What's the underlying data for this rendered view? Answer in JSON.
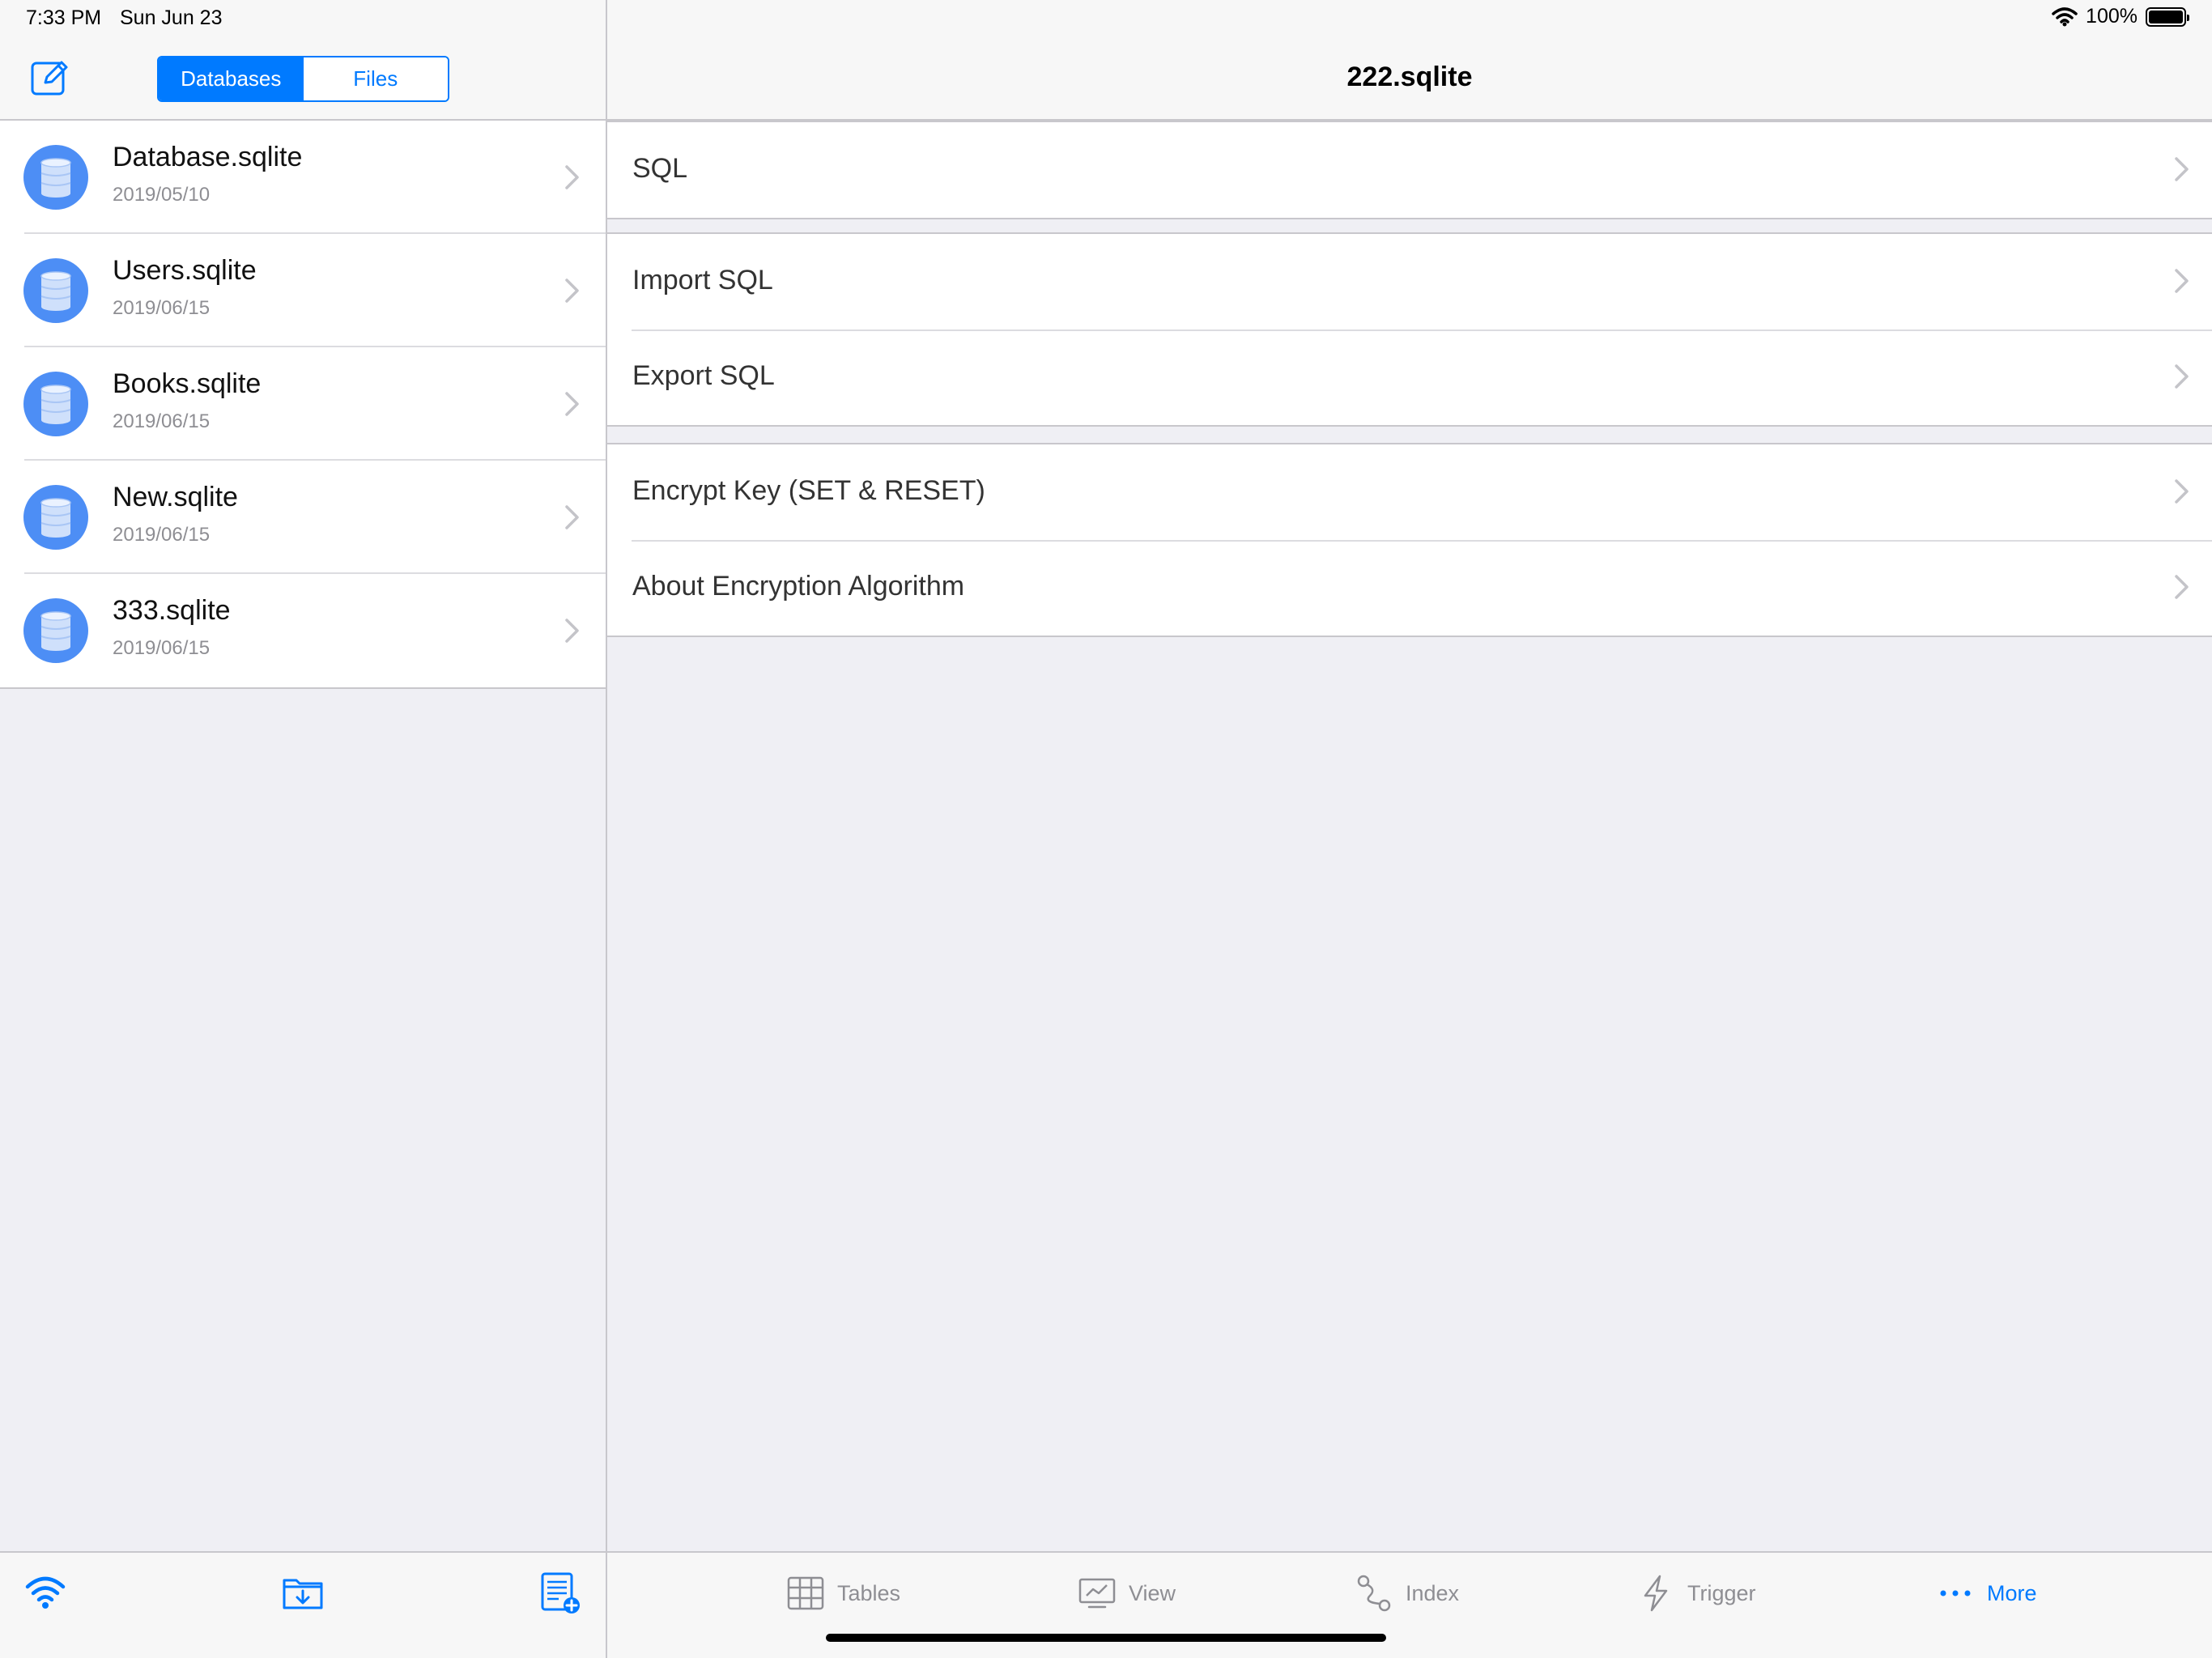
{
  "status_bar": {
    "time": "7:33 PM",
    "date": "Sun Jun 23",
    "battery": "100%",
    "battery_level": 1.0
  },
  "left": {
    "segments": [
      {
        "label": "Databases",
        "selected": true
      },
      {
        "label": "Files",
        "selected": false
      }
    ],
    "databases": [
      {
        "name": "Database.sqlite",
        "date": "2019/05/10"
      },
      {
        "name": "Users.sqlite",
        "date": "2019/06/15"
      },
      {
        "name": "Books.sqlite",
        "date": "2019/06/15"
      },
      {
        "name": "New.sqlite",
        "date": "2019/06/15"
      },
      {
        "name": "333.sqlite",
        "date": "2019/06/15"
      }
    ],
    "toolbar_icons": [
      "wifi-icon",
      "import-folder-icon",
      "new-document-icon"
    ]
  },
  "right": {
    "title": "222.sqlite",
    "groups": [
      [
        "SQL"
      ],
      [
        "Import SQL",
        "Export SQL"
      ],
      [
        "Encrypt Key (SET & RESET)",
        "About Encryption Algorithm"
      ]
    ]
  },
  "tabbar": {
    "tabs": [
      {
        "label": "Tables",
        "icon": "table-icon",
        "active": false
      },
      {
        "label": "View",
        "icon": "view-icon",
        "active": false
      },
      {
        "label": "Index",
        "icon": "index-icon",
        "active": false
      },
      {
        "label": "Trigger",
        "icon": "trigger-icon",
        "active": false
      },
      {
        "label": "More",
        "icon": "more-icon",
        "active": true
      }
    ]
  },
  "colors": {
    "accent": "#007aff",
    "db_icon": "#4d8ef5",
    "inactive": "#8e8e93",
    "background": "#efeff4"
  }
}
